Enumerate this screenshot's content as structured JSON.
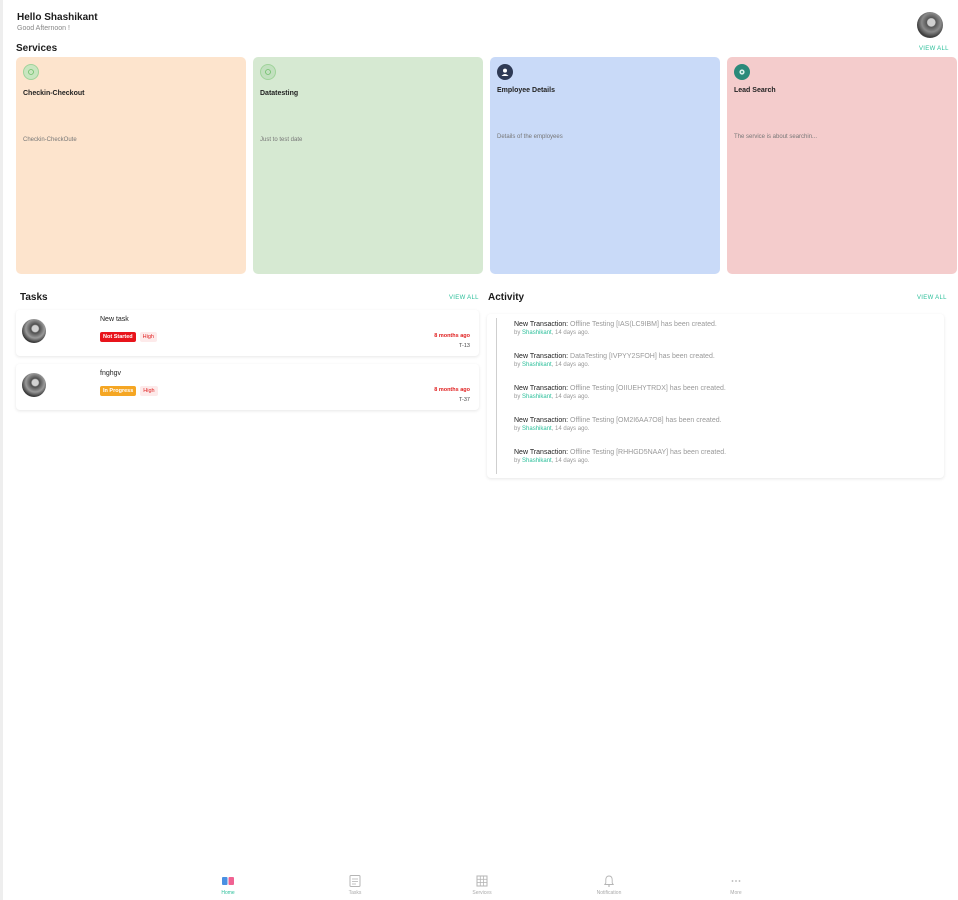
{
  "header": {
    "greeting": "Hello Shashikant",
    "subgreeting": "Good Afternoon !"
  },
  "services": {
    "title": "Services",
    "view_all": "VIEW ALL",
    "items": [
      {
        "name": "Checkin-Checkout",
        "description": "Checkin-CheckOute",
        "icon": "circle-outline-icon",
        "bg": "#fde4cd",
        "icon_bg": "#c9e6c0"
      },
      {
        "name": "Datatesting",
        "description": "Just to test date",
        "icon": "circle-outline-icon",
        "bg": "#d6e9d2",
        "icon_bg": "#c2e0bf"
      },
      {
        "name": "Employee Details",
        "description": "Details of the employees",
        "icon": "user-icon",
        "bg": "#c9daf8",
        "icon_bg": "#2e3a55"
      },
      {
        "name": "Lead Search",
        "description": "The service is about searchin...",
        "icon": "gear-icon",
        "bg": "#f4cccc",
        "icon_bg": "#2a8a7a"
      }
    ]
  },
  "tasks": {
    "title": "Tasks",
    "view_all": "VIEW ALL",
    "items": [
      {
        "title": "New task",
        "status": "Not Started",
        "status_color": "#e8141b",
        "priority": "High",
        "time": "8 months ago",
        "number": "T-13"
      },
      {
        "title": "fnghgv",
        "status": "In Progress",
        "status_color": "#f5a623",
        "priority": "High",
        "time": "8 months ago",
        "number": "T-37"
      }
    ]
  },
  "activity": {
    "title": "Activity",
    "view_all": "VIEW ALL",
    "items": [
      {
        "lead": "New Transaction:",
        "text": "Offline Testing [IAS(LC9IBM] has been created.",
        "by": "by",
        "user": "Shashikant",
        "when": "14 days ago."
      },
      {
        "lead": "New Transaction:",
        "text": "DataTesting [IVPYY2SFOH] has been created.",
        "by": "by",
        "user": "Shashikant",
        "when": "14 days ago."
      },
      {
        "lead": "New Transaction:",
        "text": "Offline Testing [OIIUEHYTRDX] has been created.",
        "by": "by",
        "user": "Shashikant",
        "when": "14 days ago."
      },
      {
        "lead": "New Transaction:",
        "text": "Offline Testing [OM2I6AA7O8] has been created.",
        "by": "by",
        "user": "Shashikant",
        "when": "14 days ago."
      },
      {
        "lead": "New Transaction:",
        "text": "Offline Testing [RHHGD5NAAY] has been created.",
        "by": "by",
        "user": "Shashikant",
        "when": "14 days ago."
      }
    ]
  },
  "bottom_nav": {
    "items": [
      {
        "label": "Home",
        "icon": "home-grid-icon",
        "active": true
      },
      {
        "label": "Tasks",
        "icon": "task-list-icon",
        "active": false
      },
      {
        "label": "Services",
        "icon": "services-grid-icon",
        "active": false
      },
      {
        "label": "Notification",
        "icon": "bell-icon",
        "active": false
      },
      {
        "label": "More",
        "icon": "more-dots-icon",
        "active": false
      }
    ]
  },
  "colors": {
    "accent": "#2bbf9a",
    "danger": "#e02020"
  }
}
